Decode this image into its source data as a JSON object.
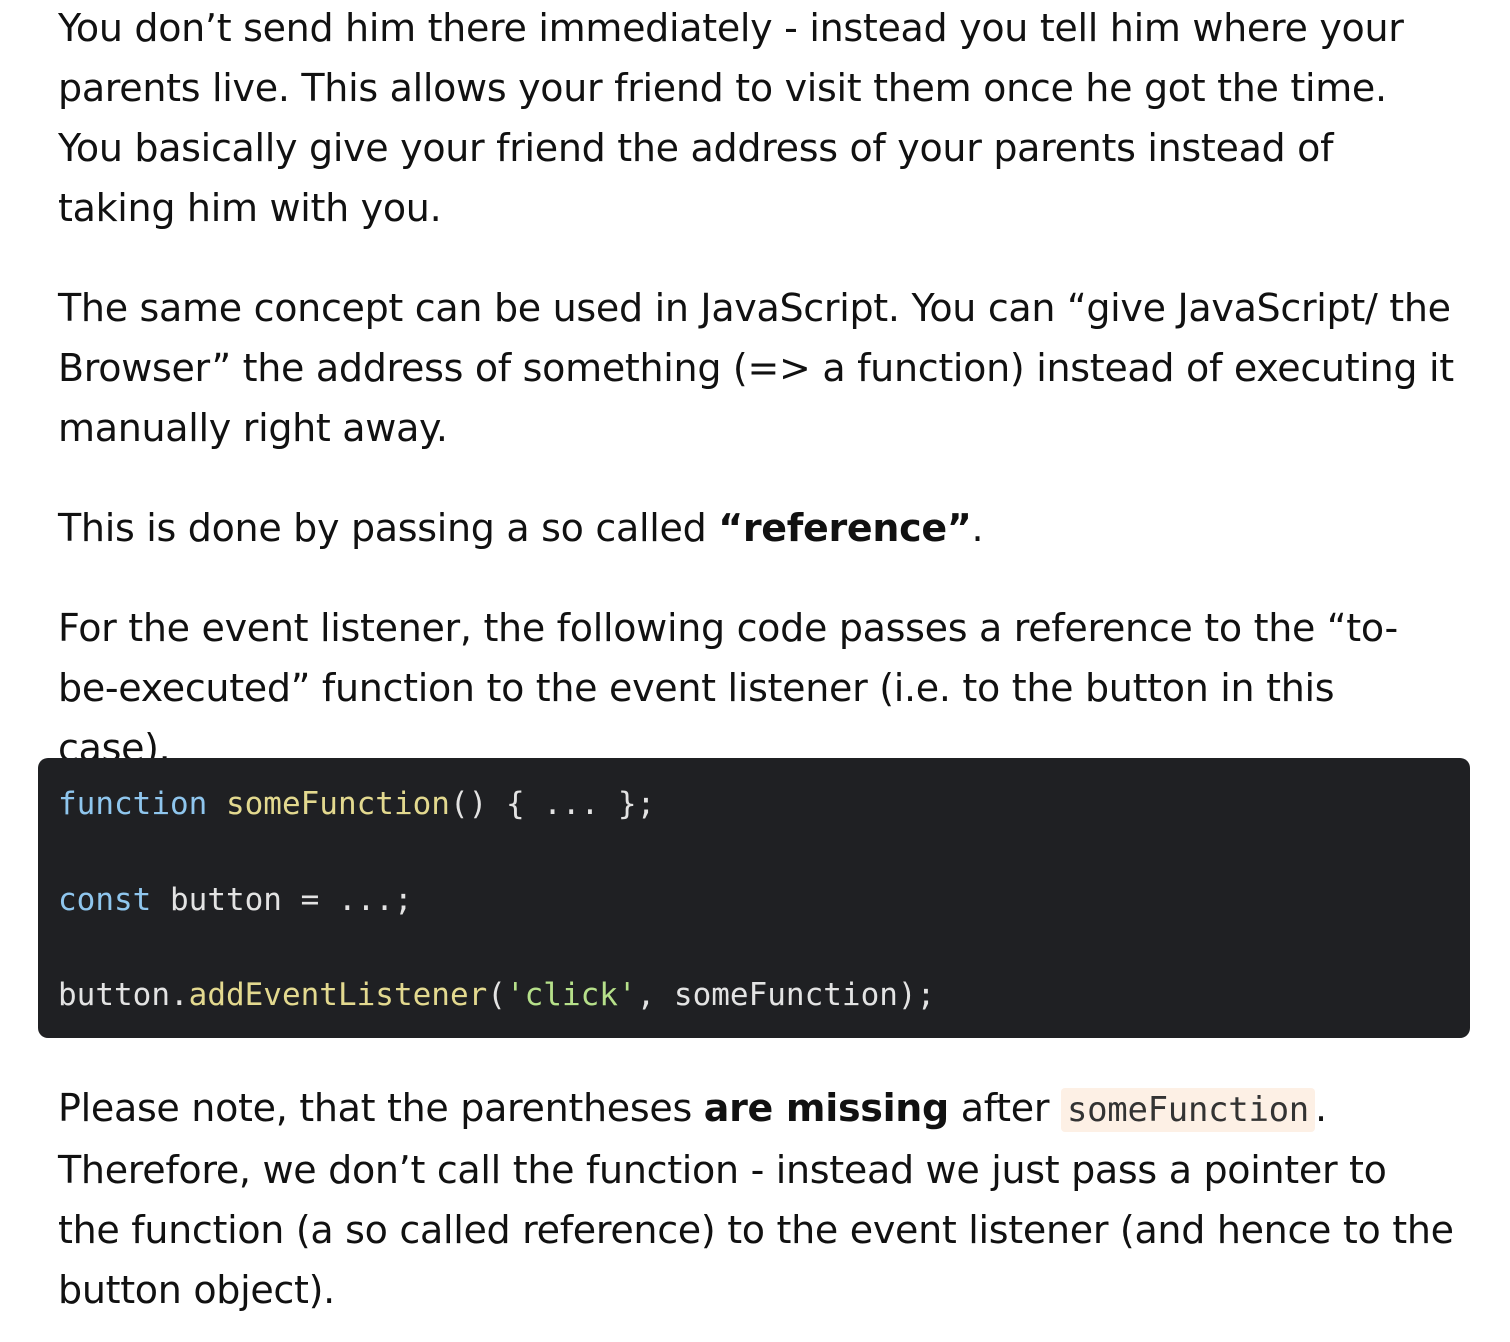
{
  "paragraphs": {
    "p1": "You don’t send him there immediately - instead you tell him where your parents live. This allows your friend to visit them once he got the time. You basically give your friend the address of your parents instead of taking him with you.",
    "p2": "The same concept can be used in JavaScript. You can “give JavaScript/ the Browser” the address of something (=> a function) instead of executing it manually right away.",
    "p3_prefix": "This is done by passing a so called ",
    "p3_bold": "“reference”",
    "p3_suffix": ".",
    "p4": "For the event listener, the following code passes a reference to the “to-be-executed” function to the event listener (i.e. to the button in this case).",
    "p5_prefix": "Please note, that the parentheses ",
    "p5_bold": "are missing",
    "p5_mid": " after ",
    "p5_code": "someFunction",
    "p5_suffix": ". Therefore, we don’t call the function - instead we just pass a pointer to the function (a so called reference) to the event listener (and hence to the button object)."
  },
  "code": {
    "line1": {
      "keyword": "function",
      "space": " ",
      "name": "someFunction",
      "rest": "() { ... };"
    },
    "line2": {
      "keyword": "const",
      "rest": " button = ...;"
    },
    "line3": {
      "obj": "button.",
      "method": "addEventListener",
      "open": "(",
      "str": "'click'",
      "rest": ", someFunction);"
    }
  },
  "colors": {
    "code_background": "#1f2023",
    "keyword": "#8fc6ee",
    "function_name": "#e3d98f",
    "string": "#b6e08a",
    "inline_code_background": "#fdf0e5"
  }
}
